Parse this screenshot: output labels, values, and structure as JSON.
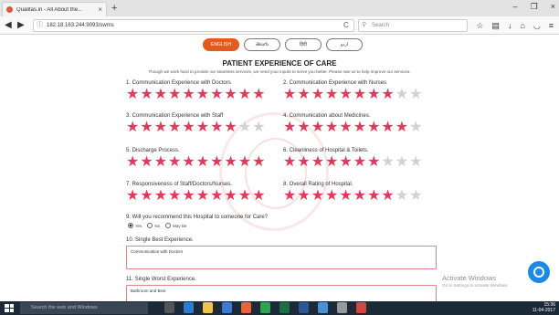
{
  "browser": {
    "tab_title": "Qualitas.in - All About the...",
    "url": "182.18.163.244:9093/swms",
    "search_placeholder": "Search"
  },
  "languages": [
    "ENGLISH",
    "తెలుగు",
    "हिंदी",
    "اردو"
  ],
  "form": {
    "title": "PATIENT EXPERIENCE OF CARE",
    "subtitle": "Though we work hard to provide our seamless services, we need your inputs to serve you better. Please rate us to help improve our services.",
    "questions": [
      {
        "label": "1. Communication Experience with Doctors",
        "rating": 10
      },
      {
        "label": "2. Communication Experience with Nurses",
        "rating": 8
      },
      {
        "label": "3. Communication Experience with Staff",
        "rating": 8
      },
      {
        "label": "4. Communication about Medicines.",
        "rating": 9
      },
      {
        "label": "5. Discharge Process.",
        "rating": 10
      },
      {
        "label": "6. Cleanliness of Hospital & Toilets.",
        "rating": 7
      },
      {
        "label": "7. Responsiveness of Staff/Doctors/Nurses.",
        "rating": 10
      },
      {
        "label": "8. Overall Rating of Hospital.",
        "rating": 8
      }
    ],
    "q9": {
      "label": "9. Will you recommend this Hospital to someone for Care?",
      "options": [
        "Yes",
        "No",
        "May Be"
      ],
      "selected": "Yes"
    },
    "q10": {
      "label": "10. Single Best Experience.",
      "value": "Communication with Doctors"
    },
    "q11": {
      "label": "11. Single Worst Experience.",
      "value": "Bathroom and Bine"
    }
  },
  "activation": {
    "title": "Activate Windows",
    "text": "Go to Settings to activate Windows."
  },
  "taskbar": {
    "search_placeholder": "Search the web and Windows",
    "time": "15:36",
    "date": "11-04-2017"
  },
  "colors": {
    "star_on": "#e03a5d",
    "star_off": "#d1d1d1",
    "lang_active": "#e55a1b"
  }
}
